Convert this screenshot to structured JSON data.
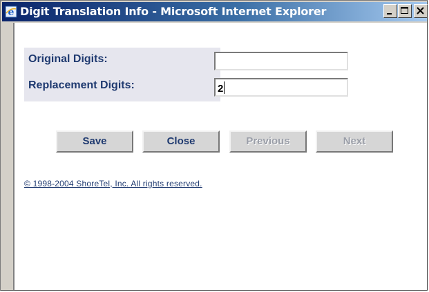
{
  "window": {
    "title": "Digit Translation Info - Microsoft Internet Explorer",
    "icon": "internet-explorer-icon",
    "controls": [
      "minimize",
      "maximize",
      "close"
    ]
  },
  "form": {
    "original_digits": {
      "label": "Original Digits:",
      "value": ""
    },
    "replacement_digits": {
      "label": "Replacement Digits:",
      "value": "2"
    }
  },
  "buttons": {
    "save": "Save",
    "close": "Close",
    "previous": "Previous",
    "next": "Next"
  },
  "footer": {
    "copyright": "© 1998-2004 ShoreTel, Inc. All rights reserved."
  },
  "colors": {
    "titlebar_start": "#0a246a",
    "titlebar_end": "#a6caf0",
    "label_text": "#1f3a70",
    "disabled_text": "#9a9ea8"
  }
}
